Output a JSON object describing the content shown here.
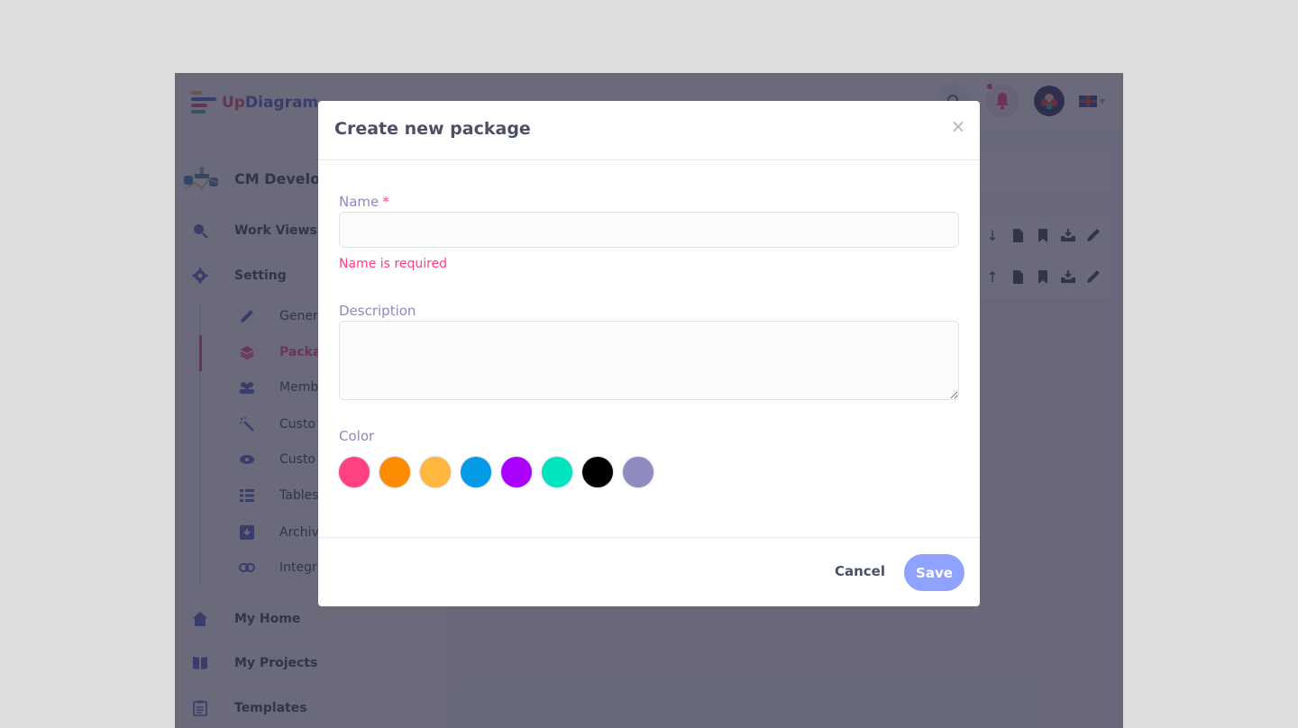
{
  "app": {
    "logo": {
      "part1": "Up",
      "part2": "Diagram"
    },
    "topbar": {
      "search_icon": "search-icon",
      "notification_icon": "bell-icon",
      "avatar_icon": "user-avatar",
      "language": "en-GB"
    },
    "sidebar": {
      "project_name": "CM Develop",
      "items": [
        {
          "label": "Work Views",
          "icon": "search-icon"
        },
        {
          "label": "Setting",
          "icon": "gear-icon"
        }
      ],
      "sub_items": [
        {
          "label": "Gener",
          "icon": "pencil-icon"
        },
        {
          "label": "Packa",
          "icon": "layers-icon",
          "active": true
        },
        {
          "label": "Memb",
          "icon": "users-icon"
        },
        {
          "label": "Custo",
          "icon": "magic-wand-icon"
        },
        {
          "label": "Custo",
          "icon": "eye-icon"
        },
        {
          "label": "Tables",
          "icon": "list-icon"
        },
        {
          "label": "Archiv",
          "icon": "archive-icon"
        },
        {
          "label": "Integr",
          "icon": "link-icon"
        }
      ],
      "bottom_items": [
        {
          "label": "My Home",
          "icon": "home-icon"
        },
        {
          "label": "My Projects",
          "icon": "book-icon"
        },
        {
          "label": "Templates",
          "icon": "clipboard-icon"
        }
      ]
    },
    "content": {
      "rows": [
        {
          "actions": [
            "arrow-down",
            "copy",
            "bookmark",
            "download",
            "edit"
          ]
        },
        {
          "actions": [
            "arrow-up",
            "copy",
            "bookmark",
            "download",
            "edit"
          ]
        }
      ]
    }
  },
  "modal": {
    "title": "Create new package",
    "close_label": "×",
    "name": {
      "label": "Name",
      "required_marker": "*",
      "value": "",
      "placeholder": "",
      "error": "Name is required"
    },
    "description": {
      "label": "Description",
      "value": "",
      "placeholder": ""
    },
    "color": {
      "label": "Color",
      "options": [
        "#ff4081",
        "#ff8c00",
        "#ffb83d",
        "#039be5",
        "#aa00ff",
        "#00e5c0",
        "#000000",
        "#8e8cbe"
      ]
    },
    "cancel_label": "Cancel",
    "save_label": "Save"
  }
}
